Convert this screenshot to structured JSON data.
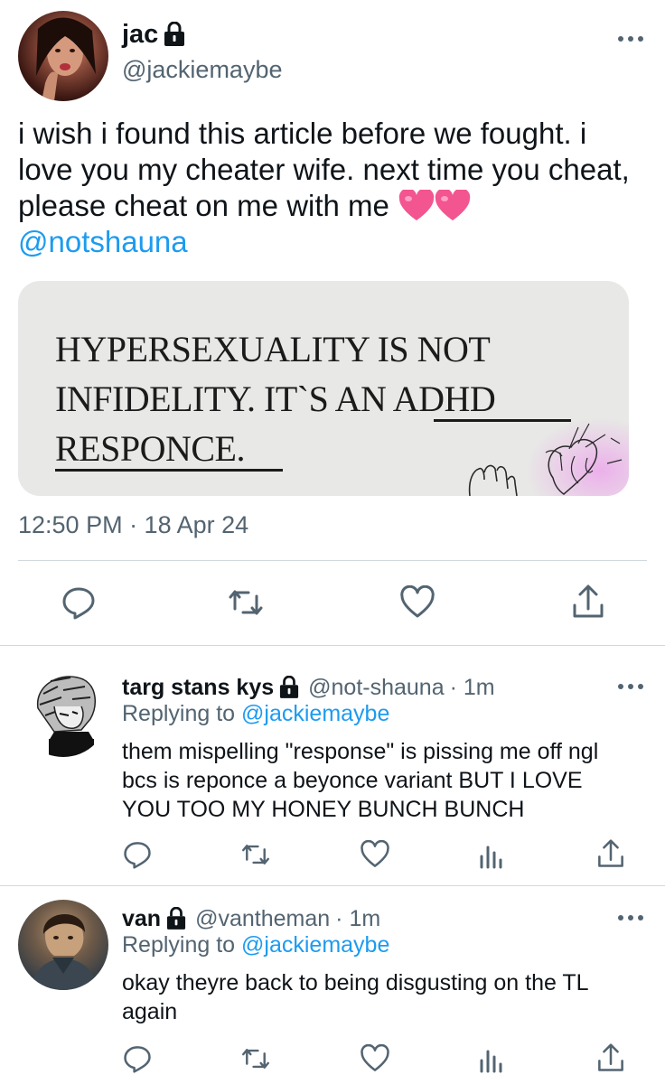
{
  "main_tweet": {
    "display_name": "jac",
    "handle": "@jackiemaybe",
    "text_lines": [
      "i wish i found this article before we fought. i",
      "love you my cheater wife. next time you cheat,",
      "please cheat on me with me"
    ],
    "emoji": "💗💗",
    "mention": "@notshauna",
    "article_lines": [
      "HYPERSEXUALITY IS NOT",
      "INFIDELITY. IT`S AN ADHD",
      "RESPONCE."
    ],
    "timestamp": "12:50 PM · 18 Apr 24"
  },
  "replies": [
    {
      "display_name": "targ stans kys",
      "handle": "@not-shauna",
      "time": "· 1m",
      "replying_prefix": "Replying to",
      "replying_handle": "@jackiemaybe",
      "text_lines": [
        "them mispelling \"response\" is pissing me off ngl",
        "bcs is reponce a beyonce variant BUT I LOVE",
        "YOU TOO MY HONEY BUNCH BUNCH"
      ]
    },
    {
      "display_name": "van",
      "handle": "@vantheman",
      "time": "· 1m",
      "replying_prefix": "Replying to",
      "replying_handle": "@jackiemaybe",
      "text_lines": [
        "okay theyre back to being disgusting on the TL",
        "again"
      ]
    }
  ],
  "icons": {
    "more": "more-dots-icon",
    "protected": "lock-icon",
    "reply": "reply-bubble-icon",
    "retweet": "retweet-icon",
    "like": "heart-icon",
    "views": "analytics-icon",
    "share": "share-icon"
  },
  "colors": {
    "link": "#1d9bf0",
    "muted": "#536471",
    "divider": "#cfd9de",
    "text": "#0f1419"
  }
}
